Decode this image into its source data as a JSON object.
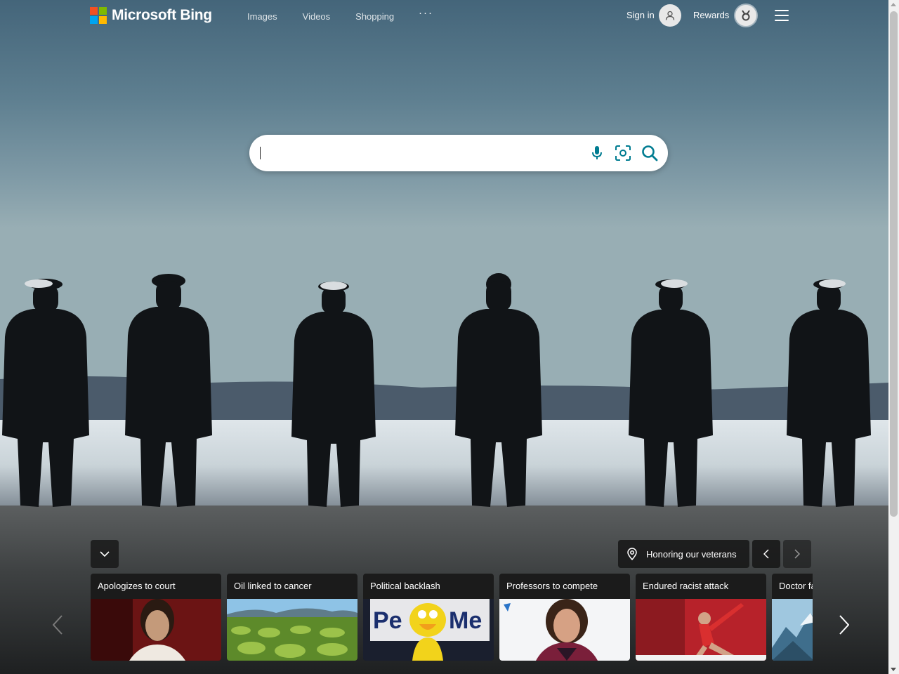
{
  "header": {
    "logo_text": "Microsoft Bing",
    "nav": [
      "Images",
      "Videos",
      "Shopping"
    ],
    "more_label": "···",
    "sign_in_label": "Sign in",
    "rewards_label": "Rewards"
  },
  "search": {
    "value": "",
    "placeholder": ""
  },
  "background": {
    "location_label": "Honoring our veterans"
  },
  "news": [
    {
      "title": "Apologizes to court"
    },
    {
      "title": "Oil linked to cancer"
    },
    {
      "title": "Political backlash"
    },
    {
      "title": "Professors to compete"
    },
    {
      "title": "Endured racist attack"
    },
    {
      "title": "Doctor fa"
    }
  ],
  "colors": {
    "accent": "#007c91",
    "sky_top": "#4f6f81",
    "water": "#e6ebee"
  },
  "icons": {
    "mic": "mic-icon",
    "visual_search": "visual-search-icon",
    "search": "search-icon",
    "location": "location-pin-icon"
  }
}
